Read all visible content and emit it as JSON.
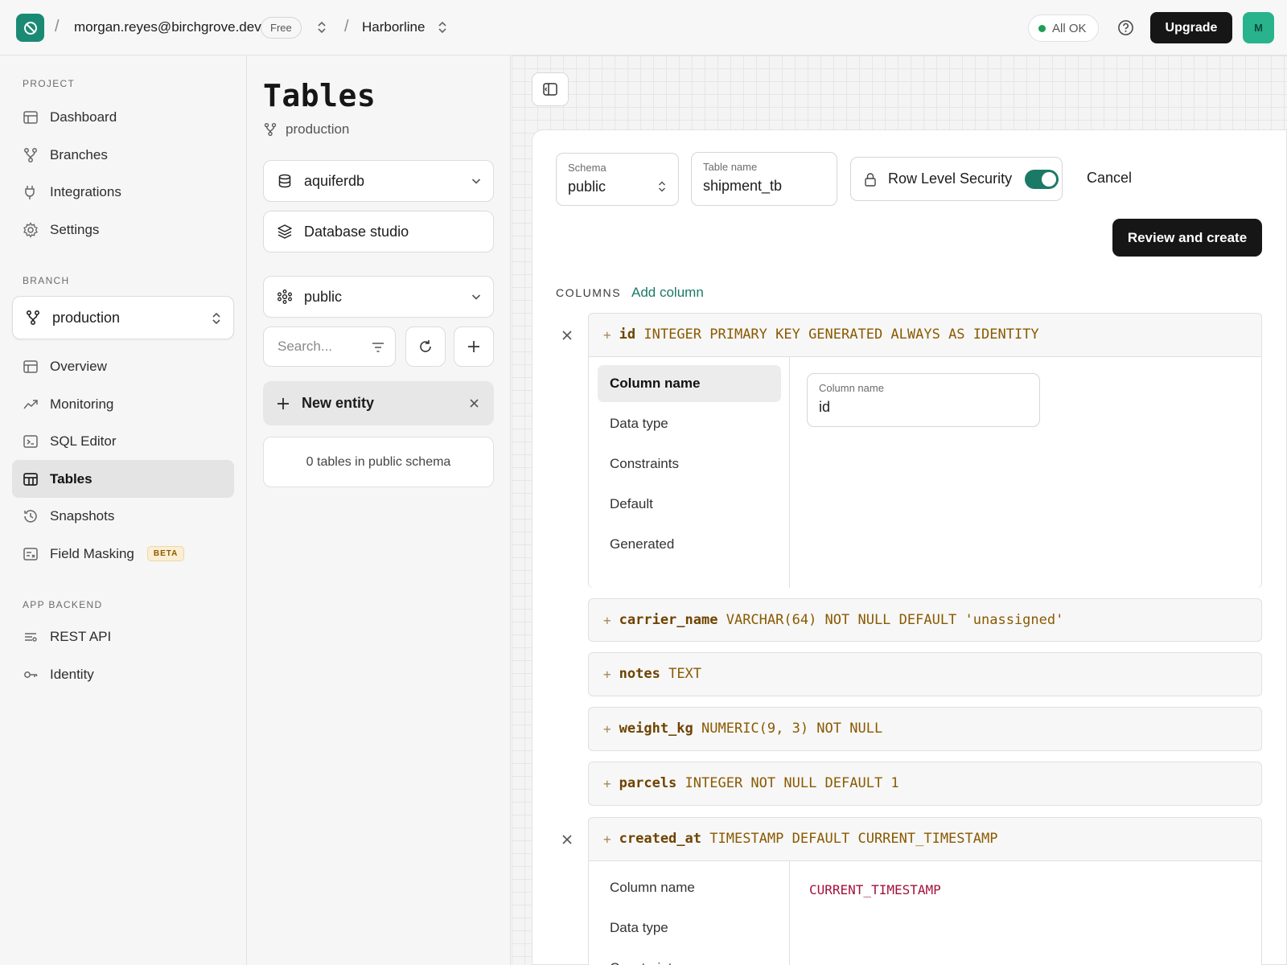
{
  "topbar": {
    "email": "morgan.reyes@birchgrove.dev",
    "plan": "Free",
    "project": "Harborline",
    "status": "All OK",
    "upgrade": "Upgrade",
    "avatar_initial": "M",
    "separator": "/"
  },
  "sidebar": {
    "project_label": "PROJECT",
    "project_items": [
      {
        "label": "Dashboard",
        "icon": "dashboard-icon"
      },
      {
        "label": "Branches",
        "icon": "branch-icon"
      },
      {
        "label": "Integrations",
        "icon": "plug-icon"
      },
      {
        "label": "Settings",
        "icon": "gear-icon"
      }
    ],
    "branch_label": "BRANCH",
    "branch_value": "production",
    "branch_items": [
      {
        "label": "Overview",
        "icon": "overview-icon"
      },
      {
        "label": "Monitoring",
        "icon": "chart-line-icon"
      },
      {
        "label": "SQL Editor",
        "icon": "terminal-icon"
      },
      {
        "label": "Tables",
        "icon": "table-icon",
        "active": true
      },
      {
        "label": "Snapshots",
        "icon": "history-icon"
      },
      {
        "label": "Field Masking",
        "icon": "mask-icon",
        "badge": "BETA"
      }
    ],
    "backend_label": "APP BACKEND",
    "backend_items": [
      {
        "label": "REST API",
        "icon": "api-icon"
      },
      {
        "label": "Identity",
        "icon": "key-icon"
      }
    ]
  },
  "panel": {
    "title": "Tables",
    "branch": "production",
    "database": "aquiferdb",
    "studio": "Database studio",
    "schema": "public",
    "search_placeholder": "Search...",
    "new_entity": "New entity",
    "table_count": "0 tables in public schema"
  },
  "editor": {
    "schema_label": "Schema",
    "schema_value": "public",
    "table_name_label": "Table name",
    "table_name_value": "shipment_tb",
    "rls_label": "Row Level Security",
    "rls_enabled": true,
    "cancel": "Cancel",
    "review": "Review and create",
    "columns_label": "COLUMNS",
    "add_column": "Add column",
    "columns": [
      {
        "name": "id",
        "def": "INTEGER PRIMARY KEY GENERATED ALWAYS AS IDENTITY",
        "expanded": true
      },
      {
        "name": "carrier_name",
        "def": "VARCHAR(64) NOT NULL DEFAULT 'unassigned'",
        "expanded": false
      },
      {
        "name": "notes",
        "def": "TEXT",
        "expanded": false
      },
      {
        "name": "weight_kg",
        "def": "NUMERIC(9, 3) NOT NULL",
        "expanded": false
      },
      {
        "name": "parcels",
        "def": "INTEGER NOT NULL DEFAULT 1",
        "expanded": false
      },
      {
        "name": "created_at",
        "def": "TIMESTAMP DEFAULT CURRENT_TIMESTAMP",
        "expanded": true
      }
    ],
    "col_tabs": [
      "Column name",
      "Data type",
      "Constraints",
      "Default",
      "Generated"
    ],
    "col_name_field_label": "Column name",
    "col_name_field_value": "id",
    "created_at_default": "CURRENT_TIMESTAMP",
    "plus": "+"
  },
  "colors": {
    "accent": "#1b7a66",
    "logo": "#1b8a74",
    "status_ok": "#1f9d55"
  }
}
